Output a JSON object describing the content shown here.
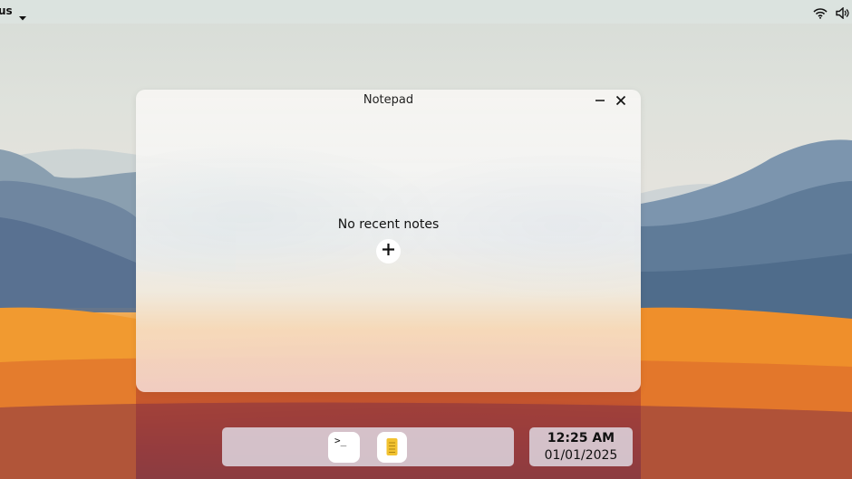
{
  "topbar": {
    "left_label": "us",
    "icons": {
      "caret": "caret-down-icon",
      "wifi": "wifi-icon",
      "volume": "volume-icon"
    }
  },
  "window": {
    "title": "Notepad",
    "empty_message": "No recent notes",
    "icons": {
      "minimize": "minimize-icon",
      "close": "close-icon",
      "add": "plus-icon"
    }
  },
  "dock": {
    "apps": [
      {
        "name": "Terminal",
        "icon": "terminal-icon",
        "glyph": ">_"
      },
      {
        "name": "Notepad",
        "icon": "notepad-icon"
      }
    ]
  },
  "clock": {
    "time": "12:25 AM",
    "date": "01/01/2025"
  },
  "colors": {
    "notepad_icon": "#f2c230",
    "window_bg": "#f5f4f1",
    "dock_bg": "#e2dee8"
  }
}
